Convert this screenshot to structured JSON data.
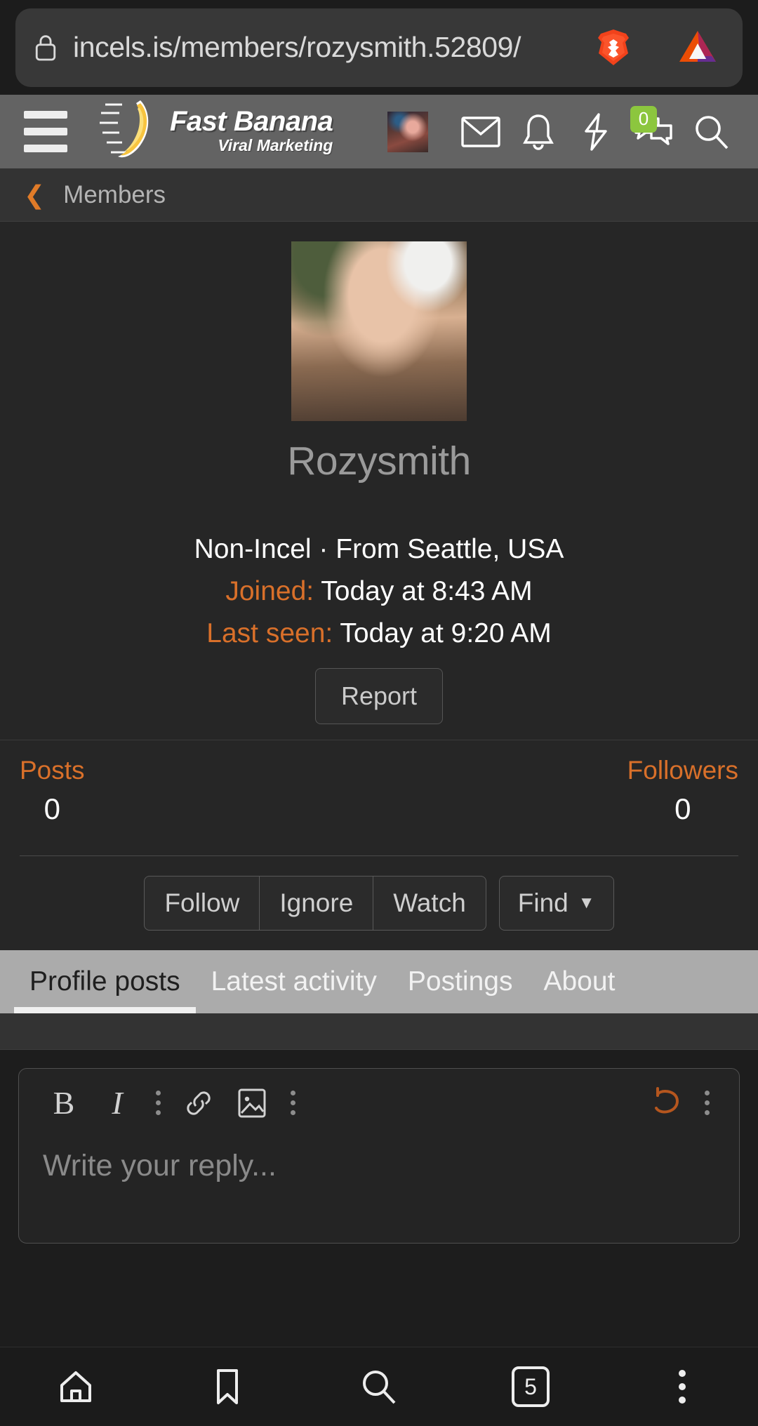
{
  "browser": {
    "url": "incels.is/members/rozysmith.52809/",
    "lock_icon": "lock-icon",
    "shield_icon": "brave-shield-icon",
    "rewards_icon": "brave-rewards-bat-icon"
  },
  "site_header": {
    "menu_icon": "hamburger-menu-icon",
    "logo": {
      "line1": "Fast Banana",
      "line2": "Viral Marketing",
      "glyph": "banana-logo-icon"
    },
    "icons": [
      {
        "name": "user-avatar",
        "label": ""
      },
      {
        "name": "inbox-envelope-icon",
        "label": ""
      },
      {
        "name": "alerts-bell-icon",
        "label": ""
      },
      {
        "name": "lightning-bolt-icon",
        "label": ""
      },
      {
        "name": "conversations-icon",
        "badge": "0"
      },
      {
        "name": "search-icon",
        "label": ""
      }
    ],
    "conversations_badge": "0",
    "badge_color": "#8cc63e"
  },
  "breadcrumb": {
    "back_icon": "chevron-left-icon",
    "label": "Members",
    "accent": "#e07b28"
  },
  "profile": {
    "avatar_name": "profile-avatar-image",
    "username": "Rozysmith",
    "user_title": "Non-Incel",
    "separator": "·",
    "location": "From Seattle, USA",
    "joined_label": "Joined:",
    "joined_value": "Today at 8:43 AM",
    "last_seen_label": "Last seen:",
    "last_seen_value": "Today at 9:20 AM",
    "report_label": "Report"
  },
  "stats": [
    {
      "label": "Posts",
      "value": "0"
    },
    {
      "label": "Followers",
      "value": "0"
    }
  ],
  "actions": {
    "group": [
      "Follow",
      "Ignore",
      "Watch"
    ],
    "find_label": "Find",
    "find_caret": "▼"
  },
  "tabs": [
    {
      "label": "Profile posts",
      "active": true
    },
    {
      "label": "Latest activity",
      "active": false
    },
    {
      "label": "Postings",
      "active": false
    },
    {
      "label": "About",
      "active": false
    }
  ],
  "editor": {
    "bold_label": "B",
    "italic_label": "I",
    "link_icon": "link-icon",
    "image_icon": "image-icon",
    "undo_icon": "undo-icon",
    "more_icon": "more-vertical-icon",
    "placeholder": "Write your reply...",
    "value": "",
    "undo_color": "#b5561e"
  },
  "bottom_nav": {
    "items": [
      {
        "name": "home-icon",
        "label": ""
      },
      {
        "name": "bookmark-icon",
        "label": ""
      },
      {
        "name": "search-icon",
        "label": ""
      },
      {
        "name": "tab-count-box",
        "label": "5"
      },
      {
        "name": "more-vertical-icon",
        "label": ""
      }
    ],
    "tab_count": "5"
  },
  "theme": {
    "page_bg": "#262626",
    "header_gray": "#636363",
    "tabs_bar": "#ababab",
    "accent_orange": "#d9702a"
  }
}
